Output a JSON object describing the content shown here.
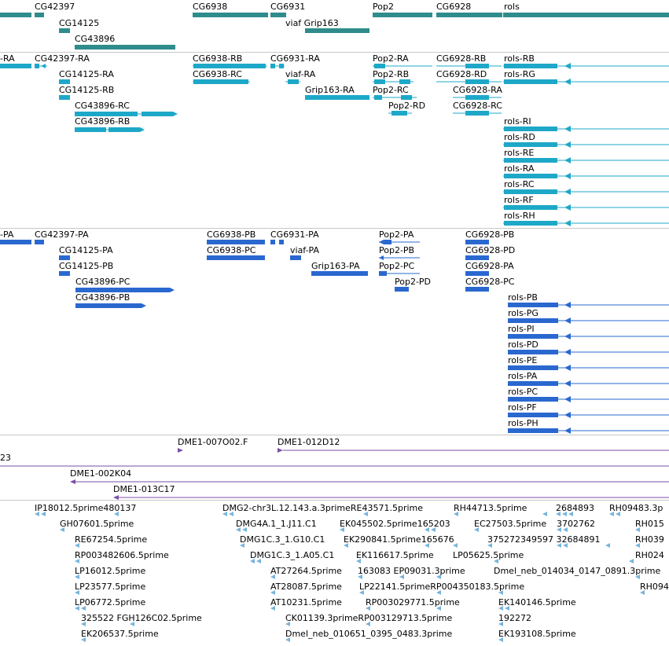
{
  "colors": {
    "gene": "#2f8c8c",
    "transcript": "#1ea8c8",
    "cds": "#2a68d0",
    "clone": "#7a4fa8",
    "est": "#78b4dc",
    "border": "#c8c8c8"
  },
  "tracks": [
    {
      "name": "genes",
      "glyph": "gene",
      "features": [
        {
          "label": "CG42397"
        },
        {
          "label": "CG14125"
        },
        {
          "label": "CG43896"
        },
        {
          "label": "CG6938"
        },
        {
          "label": "CG6931"
        },
        {
          "label": "viaf Grip163"
        },
        {
          "label": "Pop2"
        },
        {
          "label": "CG6928"
        },
        {
          "label": "rols"
        }
      ]
    },
    {
      "name": "transcripts",
      "glyph": "transcript",
      "features": [
        {
          "label": "-RA"
        },
        {
          "label": "CG42397-RA"
        },
        {
          "label": "CG14125-RA"
        },
        {
          "label": "CG14125-RB"
        },
        {
          "label": "CG43896-RC"
        },
        {
          "label": "CG43896-RB"
        },
        {
          "label": "CG6938-RB"
        },
        {
          "label": "CG6938-RC"
        },
        {
          "label": "CG6931-RA"
        },
        {
          "label": "viaf-RA"
        },
        {
          "label": "Grip163-RA"
        },
        {
          "label": "Pop2-RA"
        },
        {
          "label": "Pop2-RB"
        },
        {
          "label": "Pop2-RC"
        },
        {
          "label": "Pop2-RD"
        },
        {
          "label": "CG6928-RB"
        },
        {
          "label": "CG6928-RD"
        },
        {
          "label": "CG6928-RA"
        },
        {
          "label": "CG6928-RC"
        },
        {
          "label": "rols-RB"
        },
        {
          "label": "rols-RG"
        },
        {
          "label": "rols-RI"
        },
        {
          "label": "rols-RD"
        },
        {
          "label": "rols-RE"
        },
        {
          "label": "rols-RA"
        },
        {
          "label": "rols-RC"
        },
        {
          "label": "rols-RF"
        },
        {
          "label": "rols-RH"
        }
      ]
    },
    {
      "name": "proteins",
      "glyph": "cds",
      "features": [
        {
          "label": "-PA"
        },
        {
          "label": "CG42397-PA"
        },
        {
          "label": "CG14125-PA"
        },
        {
          "label": "CG14125-PB"
        },
        {
          "label": "CG43896-PC"
        },
        {
          "label": "CG43896-PB"
        },
        {
          "label": "CG6938-PB"
        },
        {
          "label": "CG6938-PC"
        },
        {
          "label": "CG6931-PA"
        },
        {
          "label": "viaf-PA"
        },
        {
          "label": "Grip163-PA"
        },
        {
          "label": "Pop2-PA"
        },
        {
          "label": "Pop2-PB"
        },
        {
          "label": "Pop2-PC"
        },
        {
          "label": "Pop2-PD"
        },
        {
          "label": "CG6928-PB"
        },
        {
          "label": "CG6928-PD"
        },
        {
          "label": "CG6928-PA"
        },
        {
          "label": "CG6928-PC"
        },
        {
          "label": "rols-PB"
        },
        {
          "label": "rols-PG"
        },
        {
          "label": "rols-PI"
        },
        {
          "label": "rols-PD"
        },
        {
          "label": "rols-PE"
        },
        {
          "label": "rols-PA"
        },
        {
          "label": "rols-PC"
        },
        {
          "label": "rols-PF"
        },
        {
          "label": "rols-PH"
        }
      ]
    },
    {
      "name": "clones",
      "glyph": "clone",
      "features": [
        {
          "label": "DME1-007O02.F"
        },
        {
          "label": "DME1-012D12"
        },
        {
          "label": "23"
        },
        {
          "label": "DME1-002K04"
        },
        {
          "label": "DME1-013C17"
        }
      ]
    },
    {
      "name": "ests",
      "glyph": "est",
      "features": [
        {
          "label": "IP18012.5prime480137"
        },
        {
          "label": "GH07601.5prime"
        },
        {
          "label": "RE67254.5prime"
        },
        {
          "label": "RP003482606.5prime"
        },
        {
          "label": "LP16012.5prime"
        },
        {
          "label": "LP23577.5prime"
        },
        {
          "label": "LP06772.5prime"
        },
        {
          "label": "325522 FGH126C02.5prime"
        },
        {
          "label": "EK206537.5prime"
        },
        {
          "label": "DMG2-chr3L.12.143.a.3primeRE43571.5prime"
        },
        {
          "label": "DMG4A.1_1.J11.C1"
        },
        {
          "label": "DMG1C.3_1.G10.C1"
        },
        {
          "label": "DMG1C.3_1.A05.C1"
        },
        {
          "label": "AT27264.5prime"
        },
        {
          "label": "AT28087.5prime"
        },
        {
          "label": "AT10231.5prime"
        },
        {
          "label": "CK01139.3primeRP003129713.5prime"
        },
        {
          "label": "Dmel_neb_010651_0395_0483.3prime"
        },
        {
          "label": "EK045502.5prime165203"
        },
        {
          "label": "EK290841.5prime165676"
        },
        {
          "label": "EK116617.5prime"
        },
        {
          "label": "163083 EP09031.3prime"
        },
        {
          "label": "LP22141.5primeRP004350183.5prime"
        },
        {
          "label": "RP003029771.5prime"
        },
        {
          "label": "RH44713.5prime"
        },
        {
          "label": "EC27503.5prime"
        },
        {
          "label": "LP05625.5prime"
        },
        {
          "label": "2684893"
        },
        {
          "label": "3702762"
        },
        {
          "label": "375272349597 32684891"
        },
        {
          "label": "Dmel_neb_014034_0147_0891.3prime"
        },
        {
          "label": "EK140146.5prime"
        },
        {
          "label": "192272"
        },
        {
          "label": "EK193108.5prime"
        },
        {
          "label": "RH09483.3p"
        },
        {
          "label": "RH015"
        },
        {
          "label": "RH039"
        },
        {
          "label": "RH024"
        },
        {
          "label": "RH094"
        }
      ]
    }
  ]
}
